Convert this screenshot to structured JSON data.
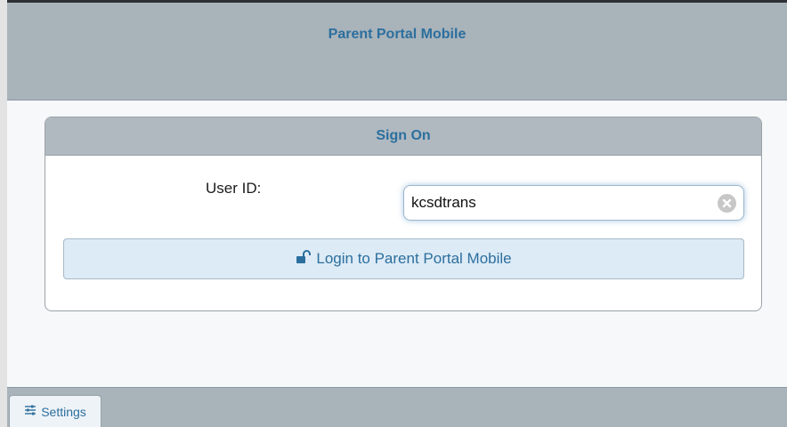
{
  "header": {
    "title": "Parent Portal Mobile"
  },
  "sign_on": {
    "title": "Sign On",
    "user_id_label": "User ID:",
    "user_id_value": "kcsdtrans",
    "login_label": "Login to Parent Portal Mobile",
    "login_icon": "unlock-icon",
    "clear_icon": "clear-x-icon"
  },
  "footer": {
    "settings_label": "Settings",
    "settings_icon": "sliders-icon"
  },
  "colors": {
    "accent": "#2c6f9e",
    "header_bg": "#a9b3ba",
    "button_bg": "#ddebf6"
  }
}
